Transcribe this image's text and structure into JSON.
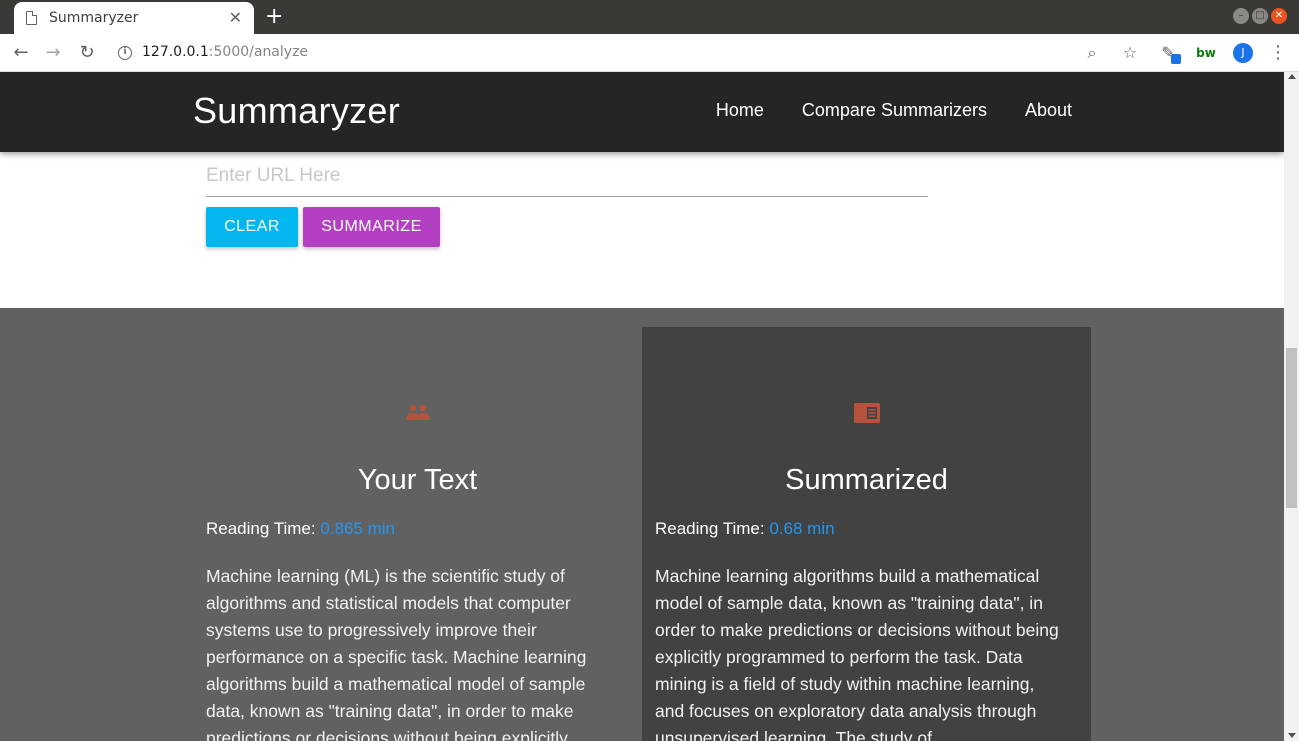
{
  "browser": {
    "tab_title": "Summaryzer",
    "url_host": "127.0.0.1",
    "url_path": ":5000/analyze",
    "avatar_initial": "J",
    "extension_label": "bw"
  },
  "navbar": {
    "brand": "Summaryzer",
    "links": [
      "Home",
      "Compare Summarizers",
      "About"
    ]
  },
  "input": {
    "placeholder": "Enter URL Here",
    "clear_label": "CLEAR",
    "summarize_label": "SUMMARIZE"
  },
  "results": {
    "original": {
      "title": "Your Text",
      "reading_label": "Reading Time:",
      "reading_value": "0.865 min",
      "text": "Machine learning (ML) is the scientific study of algorithms and statistical models that computer systems use to progressively improve their performance on a specific task. Machine learning algorithms build a mathematical model of sample data, known as \"training data\", in order to make predictions or decisions without being explicitly"
    },
    "summary": {
      "title": "Summarized",
      "reading_label": "Reading Time:",
      "reading_value": "0.68 min",
      "text": "Machine learning algorithms build a mathematical model of sample data, known as \"training data\", in order to make predictions or decisions without being explicitly programmed to perform the task. Data mining is a field of study within machine learning, and focuses on exploratory data analysis through unsupervised learning. The study of"
    }
  },
  "colors": {
    "navbar_bg": "#252525",
    "clear_button": "#03b6f0",
    "summarize_button": "#b33fc3",
    "results_bg": "#616161",
    "summary_panel_bg": "#424242",
    "reading_time_value": "#2196f3",
    "panel_icon": "#b5533c"
  },
  "icons": {
    "left_panel": "people-icon",
    "right_panel": "newspaper-icon"
  }
}
